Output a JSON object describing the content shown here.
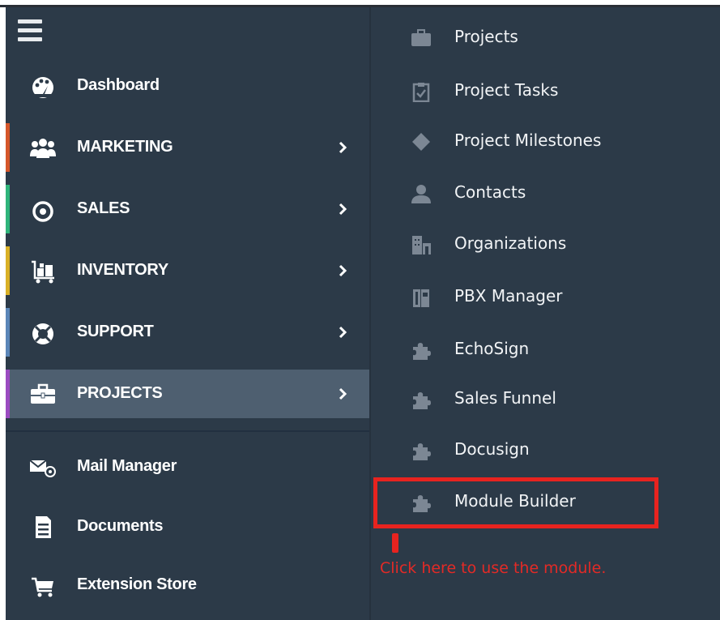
{
  "sidebar": {
    "menu_icon": "hamburger-menu-icon",
    "items": [
      {
        "label": "Dashboard",
        "icon": "palette-dashboard-icon",
        "accent": "",
        "has_submenu": false
      },
      {
        "label": "MARKETING",
        "icon": "users-group-icon",
        "accent": "#d5562a",
        "has_submenu": true
      },
      {
        "label": "SALES",
        "icon": "target-icon",
        "accent": "#2fb47a",
        "has_submenu": true
      },
      {
        "label": "INVENTORY",
        "icon": "cart-boxes-icon",
        "accent": "#d9b026",
        "has_submenu": true
      },
      {
        "label": "SUPPORT",
        "icon": "lifebuoy-icon",
        "accent": "#5b86b8",
        "has_submenu": true
      },
      {
        "label": "PROJECTS",
        "icon": "briefcase-icon",
        "accent": "#9b4bc0",
        "has_submenu": true,
        "active": true
      },
      {
        "label": "Mail Manager",
        "icon": "mail-at-icon",
        "has_submenu": false
      },
      {
        "label": "Documents",
        "icon": "document-icon",
        "has_submenu": false
      },
      {
        "label": "Extension Store",
        "icon": "cart-icon",
        "has_submenu": false
      }
    ]
  },
  "submenu": {
    "items": [
      {
        "label": "Projects",
        "icon": "briefcase-icon"
      },
      {
        "label": "Project Tasks",
        "icon": "clipboard-check-icon"
      },
      {
        "label": "Project Milestones",
        "icon": "diamond-icon"
      },
      {
        "label": "Contacts",
        "icon": "person-icon"
      },
      {
        "label": "Organizations",
        "icon": "buildings-icon"
      },
      {
        "label": "PBX Manager",
        "icon": "phone-box-icon"
      },
      {
        "label": "EchoSign",
        "icon": "puzzle-icon"
      },
      {
        "label": "Sales Funnel",
        "icon": "puzzle-icon"
      },
      {
        "label": "Docusign",
        "icon": "puzzle-icon"
      },
      {
        "label": "Module Builder",
        "icon": "puzzle-icon",
        "highlighted": true
      }
    ]
  },
  "annotation": {
    "text": "Click here to use the module.",
    "color": "#e8231f"
  },
  "colors": {
    "sidebar_bg": "#2c3a48",
    "active_bg": "#4e5f70",
    "submenu_icon": "#7c8794"
  }
}
